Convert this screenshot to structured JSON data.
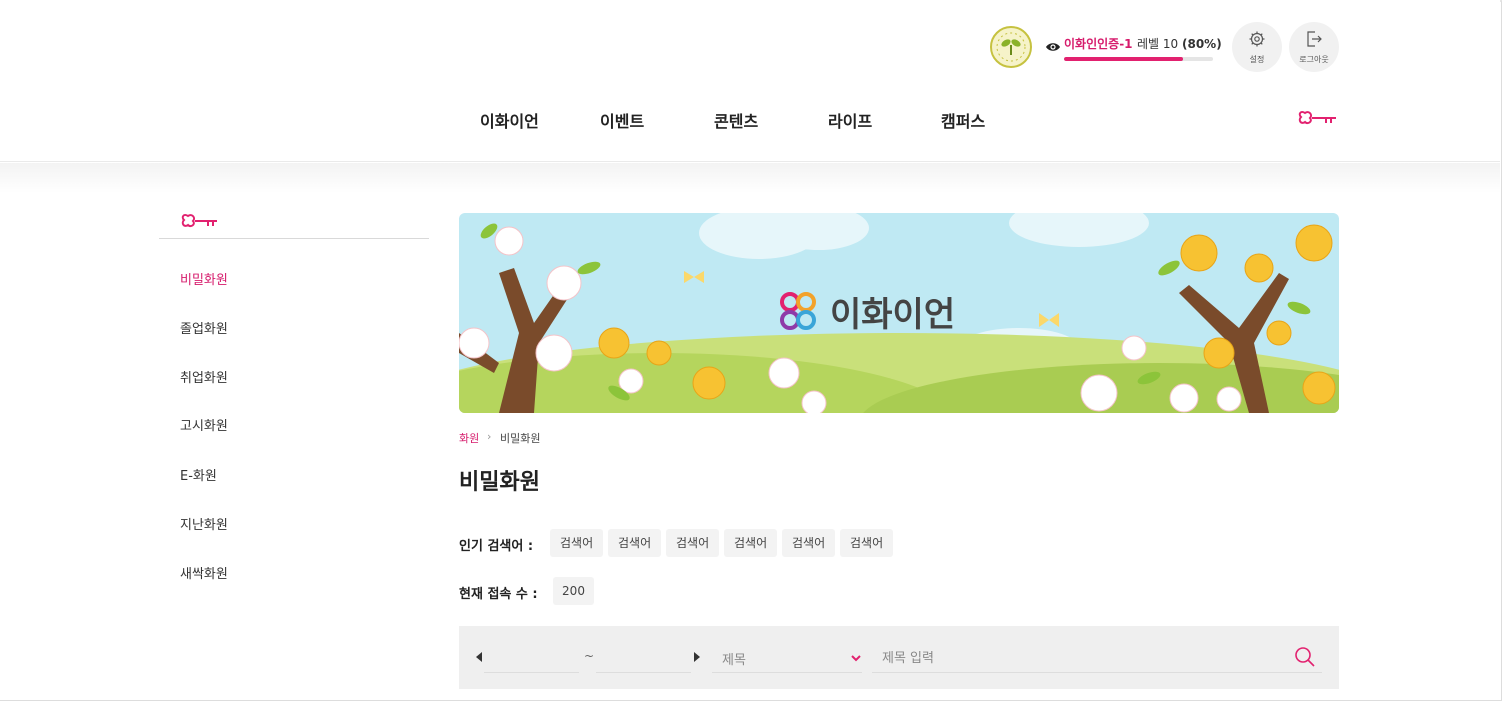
{
  "header": {
    "user_name": "이화인인증-1",
    "level_label": "레벨 10",
    "level_percent_text": "(80%)",
    "level_fraction": 0.8,
    "settings_label": "설정",
    "logout_label": "로그아웃",
    "accent_color": "#e2216f"
  },
  "nav": {
    "items": [
      "이화이언",
      "이벤트",
      "콘텐츠",
      "라이프",
      "캠퍼스"
    ]
  },
  "sidebar": {
    "items": [
      "비밀화원",
      "졸업화원",
      "취업화원",
      "고시화원",
      "E-화원",
      "지난화원",
      "새싹화원"
    ],
    "active_index": 0
  },
  "banner": {
    "logo_text": "이화이언"
  },
  "breadcrumb": {
    "home": "화원",
    "separator": "›",
    "current": "비밀화원"
  },
  "page": {
    "title": "비밀화원",
    "popular_label": "인기 검색어 :",
    "popular_tags": [
      "검색어",
      "검색어",
      "검색어",
      "검색어",
      "검색어",
      "검색어"
    ],
    "online_label": "현재 접속 수 :",
    "online_count": "200"
  },
  "search": {
    "tilde": "~",
    "select_value": "제목",
    "input_placeholder": "제목 입력"
  },
  "icons": {
    "key": "ewha-key-icon",
    "eye": "eye-icon",
    "settings": "gear-icon",
    "logout": "logout-icon",
    "search": "search-icon"
  }
}
